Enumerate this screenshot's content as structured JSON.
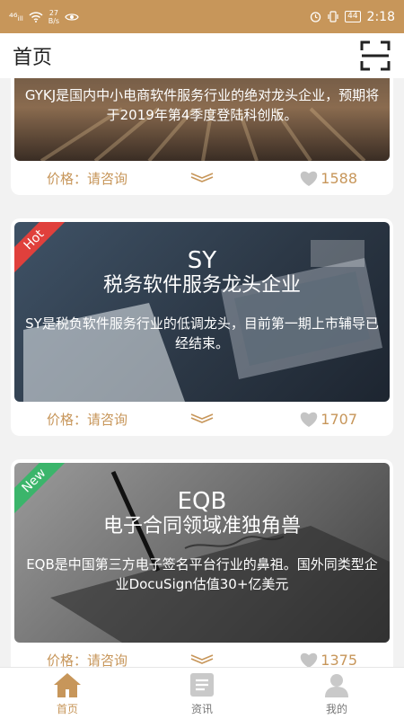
{
  "status_bar": {
    "signal": "⁴⁶ᵢₗₗ",
    "speed_value": "27",
    "speed_unit": "B/s",
    "battery": "44",
    "time": "2:18"
  },
  "header": {
    "title": "首页"
  },
  "cards": [
    {
      "name": "",
      "slogan": "",
      "desc": "GYKJ是国内中小电商软件服务行业的绝对龙头企业，预期将于2019年第4季度登陆科创版。",
      "price": "价格：请咨询",
      "likes": "1588",
      "badge": ""
    },
    {
      "name": "SY",
      "slogan": "税务软件服务龙头企业",
      "desc": "SY是税负软件服务行业的低调龙头，目前第一期上市辅导已经结束。",
      "price": "价格：请咨询",
      "likes": "1707",
      "badge": "Hot"
    },
    {
      "name": "EQB",
      "slogan": "电子合同领域准独角兽",
      "desc": "EQB是中国第三方电子签名平台行业的鼻祖。国外同类型企业DocuSign估值30+亿美元",
      "price": "价格：请咨询",
      "likes": "1375",
      "badge": "New"
    }
  ],
  "tabs": [
    {
      "label": "首页",
      "icon": "home-icon"
    },
    {
      "label": "资讯",
      "icon": "news-icon"
    },
    {
      "label": "我的",
      "icon": "profile-icon"
    }
  ],
  "colors": {
    "accent": "#c7965a",
    "hot": "#e0403c",
    "new": "#3bb56b"
  }
}
